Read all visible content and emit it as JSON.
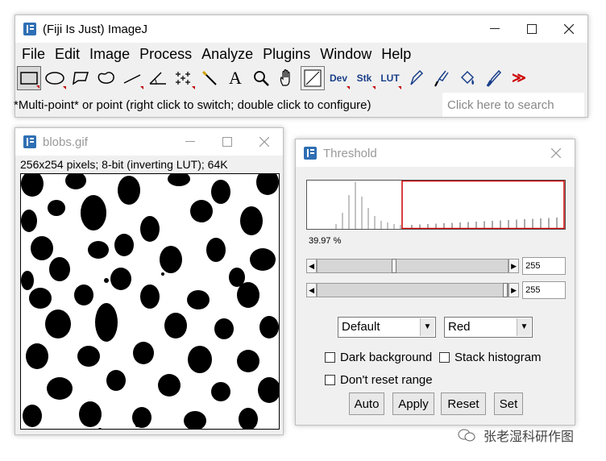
{
  "main_window": {
    "title": "(Fiji Is Just) ImageJ",
    "menus": [
      "File",
      "Edit",
      "Image",
      "Process",
      "Analyze",
      "Plugins",
      "Window",
      "Help"
    ],
    "tools": [
      {
        "name": "rectangle-tool",
        "icon": "rectangle-icon",
        "label": ""
      },
      {
        "name": "oval-tool",
        "icon": "oval-icon",
        "label": ""
      },
      {
        "name": "polygon-tool",
        "icon": "polygon-icon",
        "label": ""
      },
      {
        "name": "freehand-tool",
        "icon": "freehand-icon",
        "label": ""
      },
      {
        "name": "line-tool",
        "icon": "line-icon",
        "label": ""
      },
      {
        "name": "angle-tool",
        "icon": "angle-icon",
        "label": ""
      },
      {
        "name": "multipoint-tool",
        "icon": "multipoint-icon",
        "label": ""
      },
      {
        "name": "wand-tool",
        "icon": "wand-icon",
        "label": ""
      },
      {
        "name": "text-tool",
        "icon": "text-icon",
        "label": "A"
      },
      {
        "name": "zoom-tool",
        "icon": "magnifier-icon",
        "label": ""
      },
      {
        "name": "hand-tool",
        "icon": "hand-icon",
        "label": ""
      },
      {
        "name": "color-picker-tool",
        "icon": "color-picker-icon",
        "label": ""
      },
      {
        "name": "dev-tool",
        "icon": "dev-icon",
        "label": "Dev"
      },
      {
        "name": "stk-tool",
        "icon": "stack-icon",
        "label": "Stk"
      },
      {
        "name": "lut-tool",
        "icon": "lut-icon",
        "label": "LUT"
      },
      {
        "name": "pencil-tool",
        "icon": "pencil-icon",
        "label": ""
      },
      {
        "name": "brush-tool",
        "icon": "brush-icon",
        "label": ""
      },
      {
        "name": "flood-fill-tool",
        "icon": "flood-fill-icon",
        "label": ""
      },
      {
        "name": "paintbrush-tool",
        "icon": "paintbrush-icon",
        "label": ""
      },
      {
        "name": "more-tools",
        "icon": "double-chevron-icon",
        "label": "≫"
      }
    ],
    "status": "*Multi-point* or point (right click to switch; double click to configure)",
    "search_placeholder": "Click here to search"
  },
  "blobs_window": {
    "title": "blobs.gif",
    "info": "256x254 pixels; 8-bit (inverting LUT); 64K"
  },
  "threshold_window": {
    "title": "Threshold",
    "percent": "39.97 %",
    "min_value": "255",
    "max_value": "255",
    "min_slider_fraction": 0.4,
    "max_slider_fraction": 1.0,
    "method": "Default",
    "display": "Red",
    "dark_background_label": "Dark background",
    "dark_background_checked": false,
    "stack_histogram_label": "Stack histogram",
    "stack_histogram_checked": false,
    "dont_reset_label": "Don't reset range",
    "dont_reset_checked": false,
    "buttons": [
      "Auto",
      "Apply",
      "Reset",
      "Set"
    ],
    "highlight_color": "#cc0000"
  },
  "watermark": "张老湿科研作图"
}
